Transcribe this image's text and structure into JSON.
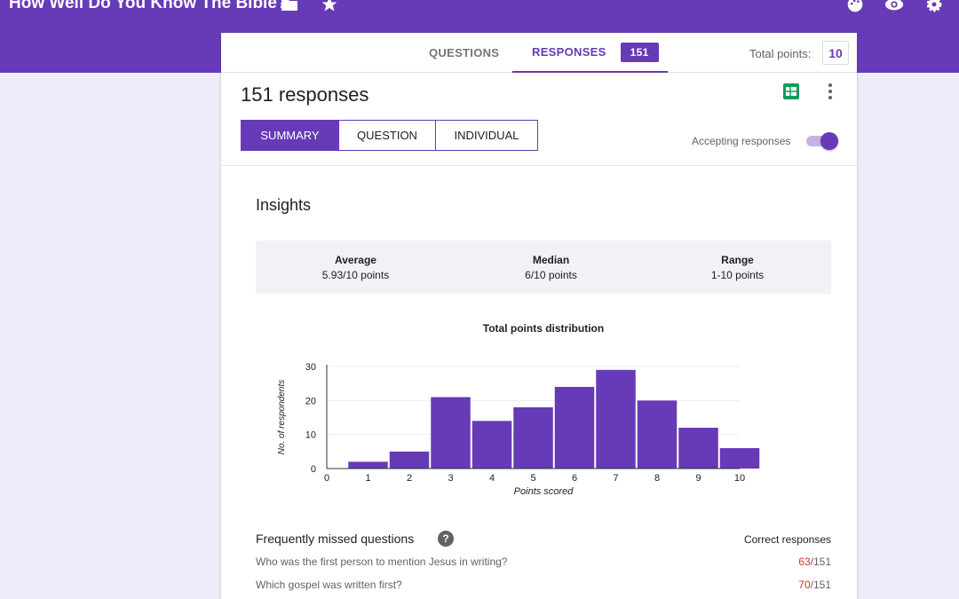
{
  "header": {
    "form_title": "How Well Do You Know The Bible?",
    "icons": [
      "folder-icon",
      "star-icon",
      "palette-icon",
      "preview-icon",
      "settings-icon"
    ],
    "accent_color": "#673ab7"
  },
  "tabs": {
    "questions_label": "QUESTIONS",
    "responses_label": "RESPONSES",
    "responses_badge": "151",
    "total_points_label": "Total points:",
    "total_points_value": "10"
  },
  "summary": {
    "response_count": "151 responses",
    "views": [
      "SUMMARY",
      "QUESTION",
      "INDIVIDUAL"
    ],
    "selected_view": "SUMMARY",
    "accepting_label": "Accepting responses",
    "accepting_on": true
  },
  "insights": {
    "title": "Insights",
    "average_label": "Average",
    "average_value": "5.93/10 points",
    "median_label": "Median",
    "median_value": "6/10 points",
    "range_label": "Range",
    "range_value": "1-10 points"
  },
  "chart_data": {
    "type": "bar",
    "title": "Total points distribution",
    "xlabel": "Points scored",
    "ylabel": "No. of respondents",
    "categories": [
      "1",
      "2",
      "3",
      "4",
      "5",
      "6",
      "7",
      "8",
      "9",
      "10"
    ],
    "values": [
      2,
      5,
      21,
      14,
      18,
      24,
      29,
      20,
      12,
      6
    ],
    "x_ticks": [
      "0",
      "1",
      "2",
      "3",
      "4",
      "5",
      "6",
      "7",
      "8",
      "9",
      "10"
    ],
    "y_ticks": [
      "0",
      "10",
      "20",
      "30"
    ],
    "ylim": [
      0,
      30
    ],
    "grid": true,
    "bar_color": "#673ab7"
  },
  "missed": {
    "title": "Frequently missed questions",
    "correct_header": "Correct responses",
    "questions": [
      {
        "text": "Who was the first person to mention Jesus in writing?",
        "correct": "63",
        "total": "/151"
      },
      {
        "text": "Which gospel was written first?",
        "correct": "70",
        "total": "/151"
      }
    ]
  }
}
